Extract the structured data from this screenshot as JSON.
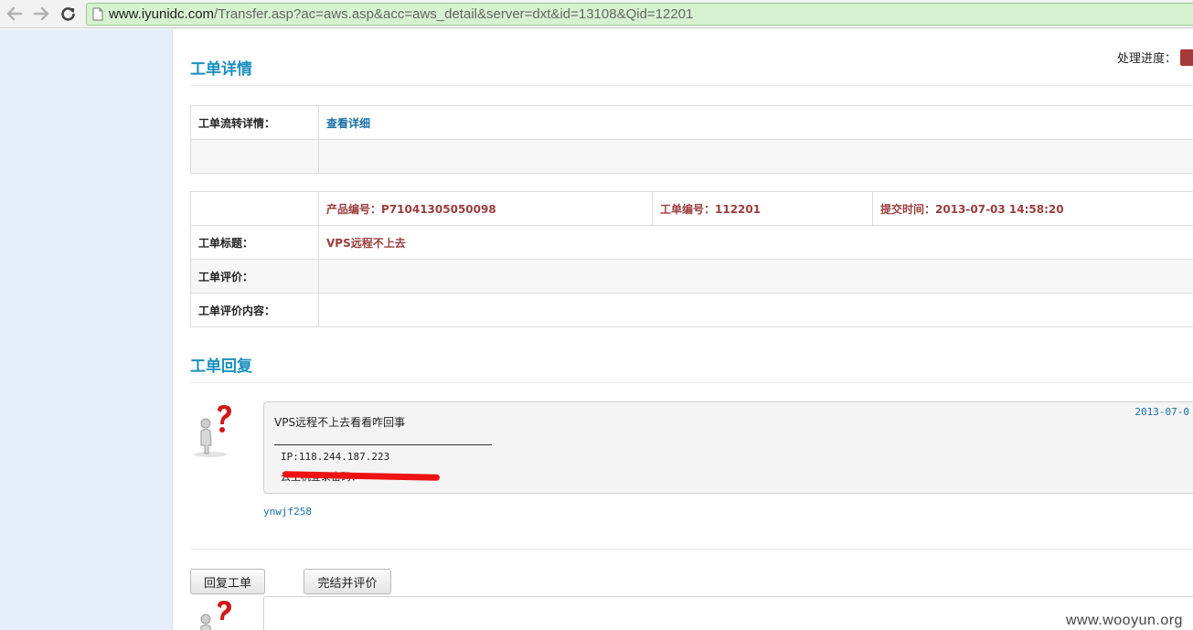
{
  "browser": {
    "url_host": "www.iyunidc.com",
    "url_path": "/Transfer.asp?ac=aws.asp&acc=aws_detail&server=dxt&id=13108&Qid=12201"
  },
  "header": {
    "title": "工单详情",
    "progress_label": "处理进度："
  },
  "flow_table": {
    "label": "工单流转详情：",
    "link": "查看详细"
  },
  "detail_table": {
    "product_no": "产品编号：P71041305050098",
    "ticket_no": "工单编号：112201",
    "submit_time": "提交时间：2013-07-03 14:58:20",
    "title_label": "工单标题：",
    "title_value": "VPS远程不上去",
    "rating_label": "工单评价：",
    "rating_content_label": "工单评价内容："
  },
  "reply": {
    "section_title": "工单回复",
    "date": "2013-07-0",
    "line1": "VPS远程不上去看看咋回事",
    "line2": "IP:118.244.187.223",
    "line3": "云主机登录密码：",
    "user": "ynwjf258"
  },
  "actions": {
    "reply_button": "回复工单",
    "finish_button": "完结并评价"
  },
  "watermark": "www.wooyun.org",
  "colors": {
    "accent_blue": "#1a8fbf",
    "link_blue": "#1a6fa5",
    "value_red": "#9a3d3d",
    "redaction": "#ee1111",
    "sidebar": "#e6eefb"
  }
}
